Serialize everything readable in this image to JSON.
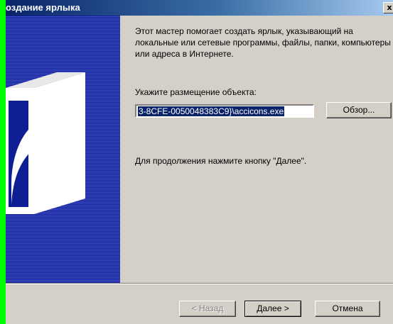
{
  "window": {
    "title": "оздание ярлыка",
    "close_glyph": "x"
  },
  "content": {
    "intro_text": "Этот мастер помогает создать ярлык, указывающий на локальные или сетевые программы, файлы, папки, компьютеры или адреса в Интернете.",
    "location_label": "Укажите размещение объекта:",
    "location_value": "3-8CFE-0050048383C9}\\accicons.exe",
    "browse_label": "Обзор...",
    "hint_text": "Для продолжения нажмите кнопку \"Далее\"."
  },
  "footer": {
    "back_label": "< Назад",
    "next_label": "Далее >",
    "cancel_label": "Отмена"
  },
  "banner": {
    "icon": "shortcut-arrow-icon"
  },
  "colors": {
    "background": "#00ff00",
    "dialog_face": "#d4d0c8",
    "title_bar": "#0a246a",
    "banner": "#0d1f93",
    "selection": "#0a246a"
  }
}
